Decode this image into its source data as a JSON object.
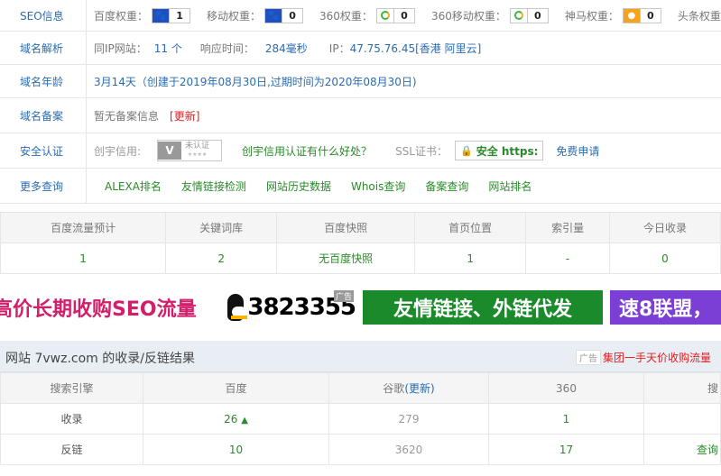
{
  "info": {
    "seo": {
      "label": "SEO信息",
      "weights": [
        {
          "name": "百度权重：",
          "value": "1",
          "icon": "baidu-paw-icon"
        },
        {
          "name": "移动权重：",
          "value": "0",
          "icon": "baidu-paw-icon"
        },
        {
          "name": "360权重：",
          "value": "0",
          "icon": "360-icon"
        },
        {
          "name": "360移动权重：",
          "value": "0",
          "icon": "360-icon"
        },
        {
          "name": "神马权重：",
          "value": "0",
          "icon": "shenma-icon"
        },
        {
          "name": "头条权重：",
          "value": "",
          "icon": "toutiao-icon"
        }
      ]
    },
    "resolve": {
      "label": "域名解析",
      "same_ip_label": "同IP网站：",
      "same_ip_value": "11 个",
      "response_label": "响应时间：",
      "response_value": "284毫秒",
      "ip_label": "IP：",
      "ip_value": "47.75.76.45[香港 阿里云]"
    },
    "age": {
      "label": "域名年龄",
      "text": "3月14天（创建于2019年08月30日,过期时间为2020年08月30日)"
    },
    "beian": {
      "label": "域名备案",
      "text": "暂无备案信息",
      "update": "[更新]"
    },
    "security": {
      "label": "安全认证",
      "chuangyu_label": "创宇信用:",
      "badge_text": "未认证",
      "badge_stars": "★★★★",
      "link": "创宇信用认证有什么好处？",
      "ssl_label": "SSL证书：",
      "ssl_badge": "安全 https:",
      "free_apply": "免费申请"
    },
    "more": {
      "label": "更多查询",
      "links": [
        "ALEXA排名",
        "友情链接检测",
        "网站历史数据",
        "Whois查询",
        "备案查询",
        "网站排名"
      ]
    }
  },
  "stats": {
    "headers": [
      "百度流量预计",
      "关键词库",
      "百度快照",
      "首页位置",
      "索引量",
      "今日收录"
    ],
    "values": [
      "1",
      "2",
      "无百度快照",
      "1",
      "-",
      "0"
    ]
  },
  "banners": [
    {
      "text": "高价长期收购SEO流量",
      "bg": "#ffffff",
      "color": "#d0206a"
    },
    {
      "text": "3823355",
      "bg": "#ffffff",
      "color": "#000000"
    },
    {
      "text": "友情链接、外链代发",
      "bg": "#1a8a2a",
      "color": "#ffffff"
    },
    {
      "text": "速8联盟，",
      "bg": "#7b3fd6",
      "color": "#ffffff"
    }
  ],
  "banner_tag": "广告",
  "result": {
    "title": "网站 7vwz.com 的收录/反链结果",
    "ad_tag": "广告",
    "ad_text": "集团一手天价收购流量",
    "headers": [
      "搜索引擎",
      "百度",
      "谷歌",
      "(更新)",
      "360",
      "搜"
    ],
    "rows": [
      {
        "name": "收录",
        "baidu": "26",
        "google": "279",
        "s360": "1",
        "sogou": ""
      },
      {
        "name": "反链",
        "baidu": "10",
        "google": "3620",
        "s360": "17",
        "sogou": "查询"
      }
    ]
  },
  "colors": {
    "link_blue": "#2b6cb0",
    "link_green": "#2a8a2a",
    "red": "#e02020"
  }
}
